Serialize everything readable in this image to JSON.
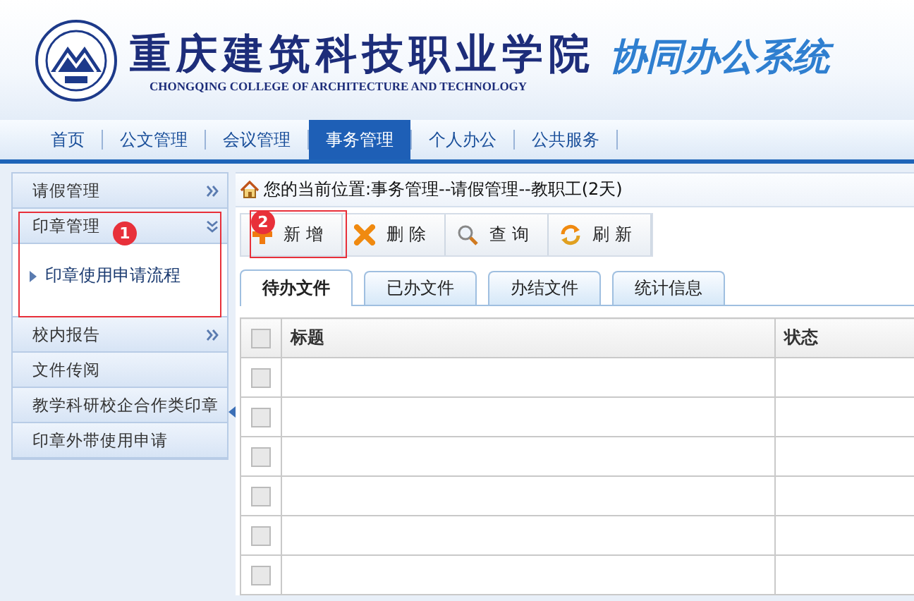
{
  "header": {
    "school_name": "重庆建筑科技职业学院",
    "school_name_en": "CHONGQING COLLEGE OF ARCHITECTURE AND TECHNOLOGY",
    "system_title": "协同办公系统"
  },
  "nav": [
    {
      "label": "首页",
      "selected": false
    },
    {
      "label": "公文管理",
      "selected": false
    },
    {
      "label": "会议管理",
      "selected": false
    },
    {
      "label": "事务管理",
      "selected": true
    },
    {
      "label": "个人办公",
      "selected": false
    },
    {
      "label": "公共服务",
      "selected": false
    }
  ],
  "sidebar": [
    {
      "label": "请假管理",
      "kind": "group",
      "expanded": false
    },
    {
      "label": "印章管理",
      "kind": "group",
      "expanded": true,
      "callout": "1",
      "children": [
        {
          "label": "印章使用申请流程"
        }
      ]
    },
    {
      "label": "校内报告",
      "kind": "group",
      "expanded": false
    },
    {
      "label": "文件传阅",
      "kind": "link"
    },
    {
      "label": "教学科研校企合作类印章",
      "kind": "link"
    },
    {
      "label": "印章外带使用申请",
      "kind": "link"
    }
  ],
  "breadcrumb": "您的当前位置:事务管理--请假管理--教职工(2天)",
  "toolbar": [
    {
      "label": "新增",
      "kind": "add",
      "callout": "2"
    },
    {
      "label": "删除",
      "kind": "delete"
    },
    {
      "label": "查询",
      "kind": "search"
    },
    {
      "label": "刷新",
      "kind": "refresh"
    }
  ],
  "tabs": [
    {
      "label": "待办文件",
      "selected": true
    },
    {
      "label": "已办文件",
      "selected": false
    },
    {
      "label": "办结文件",
      "selected": false
    },
    {
      "label": "统计信息",
      "selected": false
    }
  ],
  "table": {
    "all_checked": false,
    "columns": [
      "标题",
      "状态"
    ],
    "rows": [
      {
        "checked": false
      },
      {
        "checked": false
      },
      {
        "checked": false
      },
      {
        "checked": false
      },
      {
        "checked": false
      },
      {
        "checked": false
      }
    ]
  }
}
